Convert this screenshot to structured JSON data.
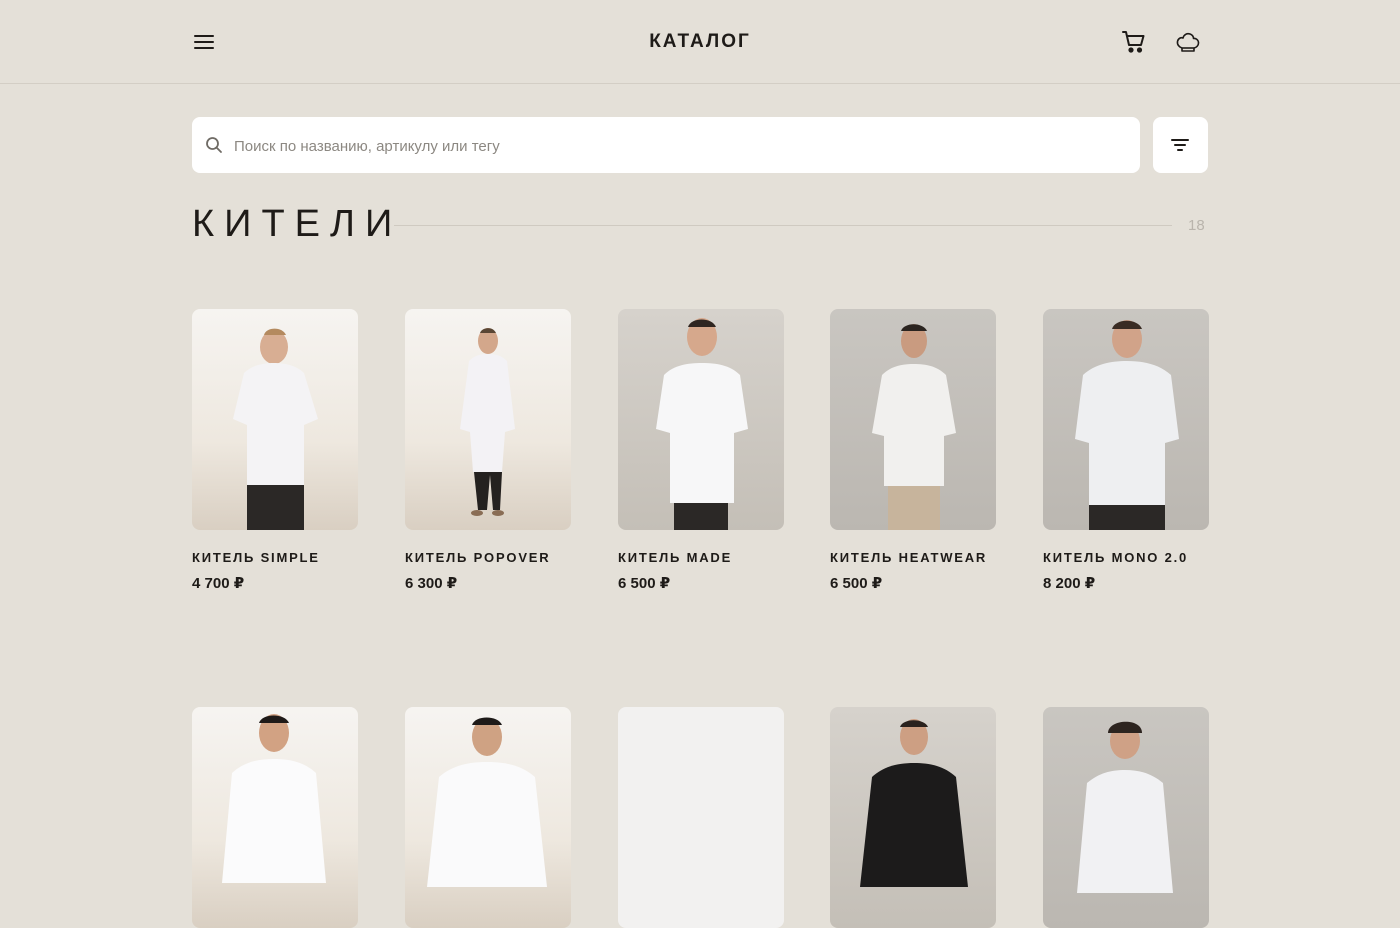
{
  "header": {
    "title": "КАТАЛОГ",
    "menu_icon": "hamburger-icon",
    "cart_icon": "cart-icon",
    "profile_icon": "chef-hat-icon"
  },
  "search": {
    "placeholder": "Поиск по названию, артикулу или тегу",
    "value": ""
  },
  "section": {
    "title": "КИТЕЛИ",
    "count": "18"
  },
  "products": [
    {
      "name": "КИТЕЛЬ SIMPLE",
      "price": "4 700 ₽"
    },
    {
      "name": "КИТЕЛЬ POPOVER",
      "price": "6 300 ₽"
    },
    {
      "name": "КИТЕЛЬ MADE",
      "price": "6 500 ₽"
    },
    {
      "name": "КИТЕЛЬ HEATWEAR",
      "price": "6 500 ₽"
    },
    {
      "name": "КИТЕЛЬ MONO 2.0",
      "price": "8 200 ₽"
    },
    {
      "name": "",
      "price": ""
    },
    {
      "name": "",
      "price": ""
    },
    {
      "name": "",
      "price": ""
    },
    {
      "name": "",
      "price": ""
    },
    {
      "name": "",
      "price": ""
    }
  ],
  "colors": {
    "background": "#e4e0d8",
    "text": "#1e1b18",
    "card_bg": "#ffffff"
  }
}
